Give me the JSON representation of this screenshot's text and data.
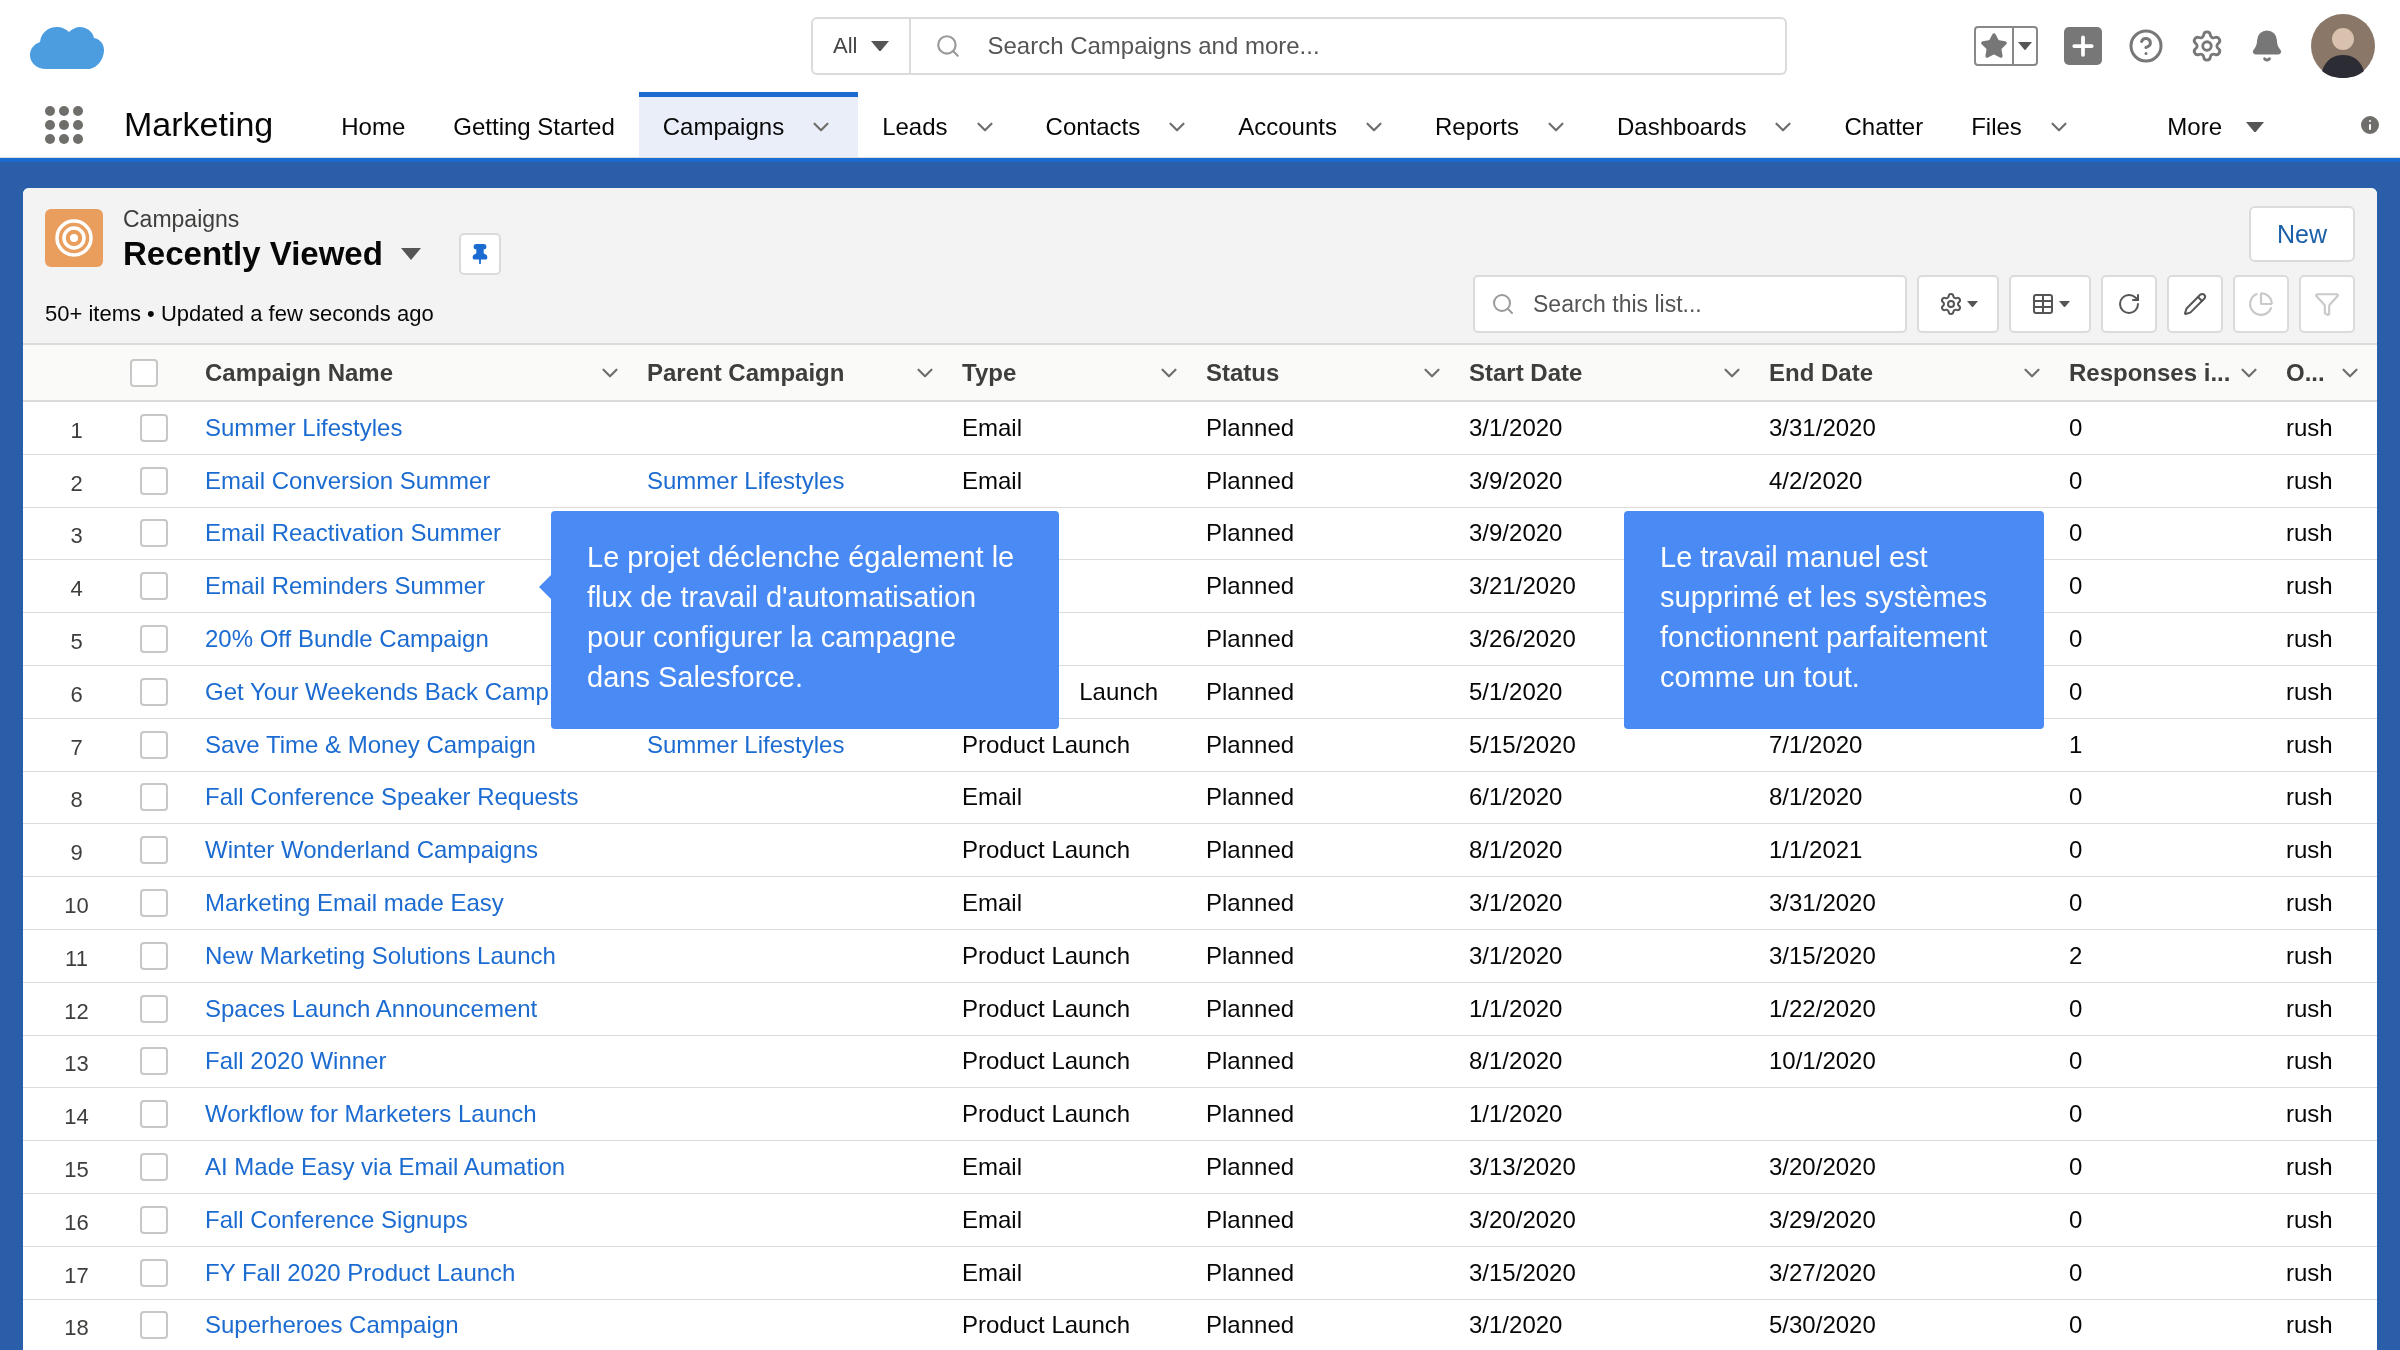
{
  "header": {
    "search_scope": "All",
    "search_placeholder": "Search Campaigns and more..."
  },
  "nav": {
    "app_name": "Marketing",
    "items": [
      {
        "label": "Home",
        "dropdown": false,
        "selected": false
      },
      {
        "label": "Getting Started",
        "dropdown": false,
        "selected": false
      },
      {
        "label": "Campaigns",
        "dropdown": true,
        "selected": true
      },
      {
        "label": "Leads",
        "dropdown": true,
        "selected": false
      },
      {
        "label": "Contacts",
        "dropdown": true,
        "selected": false
      },
      {
        "label": "Accounts",
        "dropdown": true,
        "selected": false
      },
      {
        "label": "Reports",
        "dropdown": true,
        "selected": false
      },
      {
        "label": "Dashboards",
        "dropdown": true,
        "selected": false
      },
      {
        "label": "Chatter",
        "dropdown": false,
        "selected": false
      },
      {
        "label": "Files",
        "dropdown": true,
        "selected": false
      }
    ],
    "more": "More"
  },
  "list": {
    "object": "Campaigns",
    "view": "Recently Viewed",
    "summary": "50+ items • Updated a few seconds ago",
    "new_button": "New",
    "search_placeholder": "Search this list...",
    "tools": [
      {
        "kind": "settings",
        "disabled": false
      },
      {
        "kind": "table",
        "disabled": false
      },
      {
        "kind": "refresh",
        "disabled": false
      },
      {
        "kind": "edit",
        "disabled": false
      },
      {
        "kind": "chart",
        "disabled": true
      },
      {
        "kind": "filter",
        "disabled": true
      }
    ]
  },
  "table": {
    "all_checked": false,
    "columns": [
      "Campaign Name",
      "Parent Campaign",
      "Type",
      "Status",
      "Start Date",
      "End Date",
      "Responses i...",
      "O..."
    ],
    "rows": [
      {
        "num": "1",
        "checked": false,
        "name": "Summer Lifestyles",
        "type": "Email",
        "status": "Planned",
        "start": "3/1/2020",
        "end": "3/31/2020",
        "responses": "0",
        "owner": "rush"
      },
      {
        "num": "2",
        "checked": false,
        "name": "Email Conversion Summer",
        "parent": "Summer Lifestyles",
        "type": "Email",
        "status": "Planned",
        "start": "3/9/2020",
        "end": "4/2/2020",
        "responses": "0",
        "owner": "rush"
      },
      {
        "num": "3",
        "checked": false,
        "name": "Email Reactivation Summer",
        "status": "Planned",
        "start": "3/9/2020",
        "responses": "0",
        "owner": "rush"
      },
      {
        "num": "4",
        "checked": false,
        "name": "Email Reminders Summer",
        "status": "Planned",
        "start": "3/21/2020",
        "responses": "0",
        "owner": "rush"
      },
      {
        "num": "5",
        "checked": false,
        "name": "20% Off Bundle Campaign",
        "status": "Planned",
        "start": "3/26/2020",
        "responses": "0",
        "owner": "rush"
      },
      {
        "num": "6",
        "checked": false,
        "name": "Get Your Weekends Back Camp",
        "type": "Launch",
        "type_cut": true,
        "status": "Planned",
        "start": "5/1/2020",
        "responses": "0",
        "owner": "rush"
      },
      {
        "num": "7",
        "checked": false,
        "name": "Save Time & Money Campaign",
        "parent": "Summer Lifestyles",
        "type": "Product Launch",
        "status": "Planned",
        "start": "5/15/2020",
        "end": "7/1/2020",
        "responses": "1",
        "owner": "rush"
      },
      {
        "num": "8",
        "checked": false,
        "name": "Fall Conference Speaker Requests",
        "type": "Email",
        "status": "Planned",
        "start": "6/1/2020",
        "end": "8/1/2020",
        "responses": "0",
        "owner": "rush"
      },
      {
        "num": "9",
        "checked": false,
        "name": "Winter Wonderland Campaigns",
        "type": "Product Launch",
        "status": "Planned",
        "start": "8/1/2020",
        "end": "1/1/2021",
        "responses": "0",
        "owner": "rush"
      },
      {
        "num": "10",
        "checked": false,
        "name": "Marketing Email made Easy",
        "type": "Email",
        "status": "Planned",
        "start": "3/1/2020",
        "end": "3/31/2020",
        "responses": "0",
        "owner": "rush"
      },
      {
        "num": "11",
        "checked": false,
        "name": "New Marketing Solutions Launch",
        "type": "Product Launch",
        "status": "Planned",
        "start": "3/1/2020",
        "end": "3/15/2020",
        "responses": "2",
        "owner": "rush"
      },
      {
        "num": "12",
        "checked": false,
        "name": "Spaces Launch Announcement",
        "type": "Product Launch",
        "status": "Planned",
        "start": "1/1/2020",
        "end": "1/22/2020",
        "responses": "0",
        "owner": "rush"
      },
      {
        "num": "13",
        "checked": false,
        "name": "Fall 2020 Winner",
        "type": "Product Launch",
        "status": "Planned",
        "start": "8/1/2020",
        "end": "10/1/2020",
        "responses": "0",
        "owner": "rush"
      },
      {
        "num": "14",
        "checked": false,
        "name": "Workflow for Marketers Launch",
        "type": "Product Launch",
        "status": "Planned",
        "start": "1/1/2020",
        "responses": "0",
        "owner": "rush"
      },
      {
        "num": "15",
        "checked": false,
        "name": "AI Made Easy via Email Aumation",
        "type": "Email",
        "status": "Planned",
        "start": "3/13/2020",
        "end": "3/20/2020",
        "responses": "0",
        "owner": "rush"
      },
      {
        "num": "16",
        "checked": false,
        "name": "Fall Conference Signups",
        "type": "Email",
        "status": "Planned",
        "start": "3/20/2020",
        "end": "3/29/2020",
        "responses": "0",
        "owner": "rush"
      },
      {
        "num": "17",
        "checked": false,
        "name": "FY Fall 2020 Product Launch",
        "type": "Email",
        "status": "Planned",
        "start": "3/15/2020",
        "end": "3/27/2020",
        "responses": "0",
        "owner": "rush"
      },
      {
        "num": "18",
        "checked": false,
        "name": "Superheroes Campaign",
        "type": "Product Launch",
        "status": "Planned",
        "start": "3/1/2020",
        "end": "5/30/2020",
        "responses": "0",
        "owner": "rush"
      }
    ]
  },
  "callouts": [
    {
      "text": "Le projet déclenche également le flux de travail d'automatisation pour configurer la campagne dans Salesforce.",
      "pointer": true
    },
    {
      "text": "Le travail manuel est supprimé et les systèmes fonctionnent parfaitement comme un tout.",
      "pointer": false
    }
  ]
}
